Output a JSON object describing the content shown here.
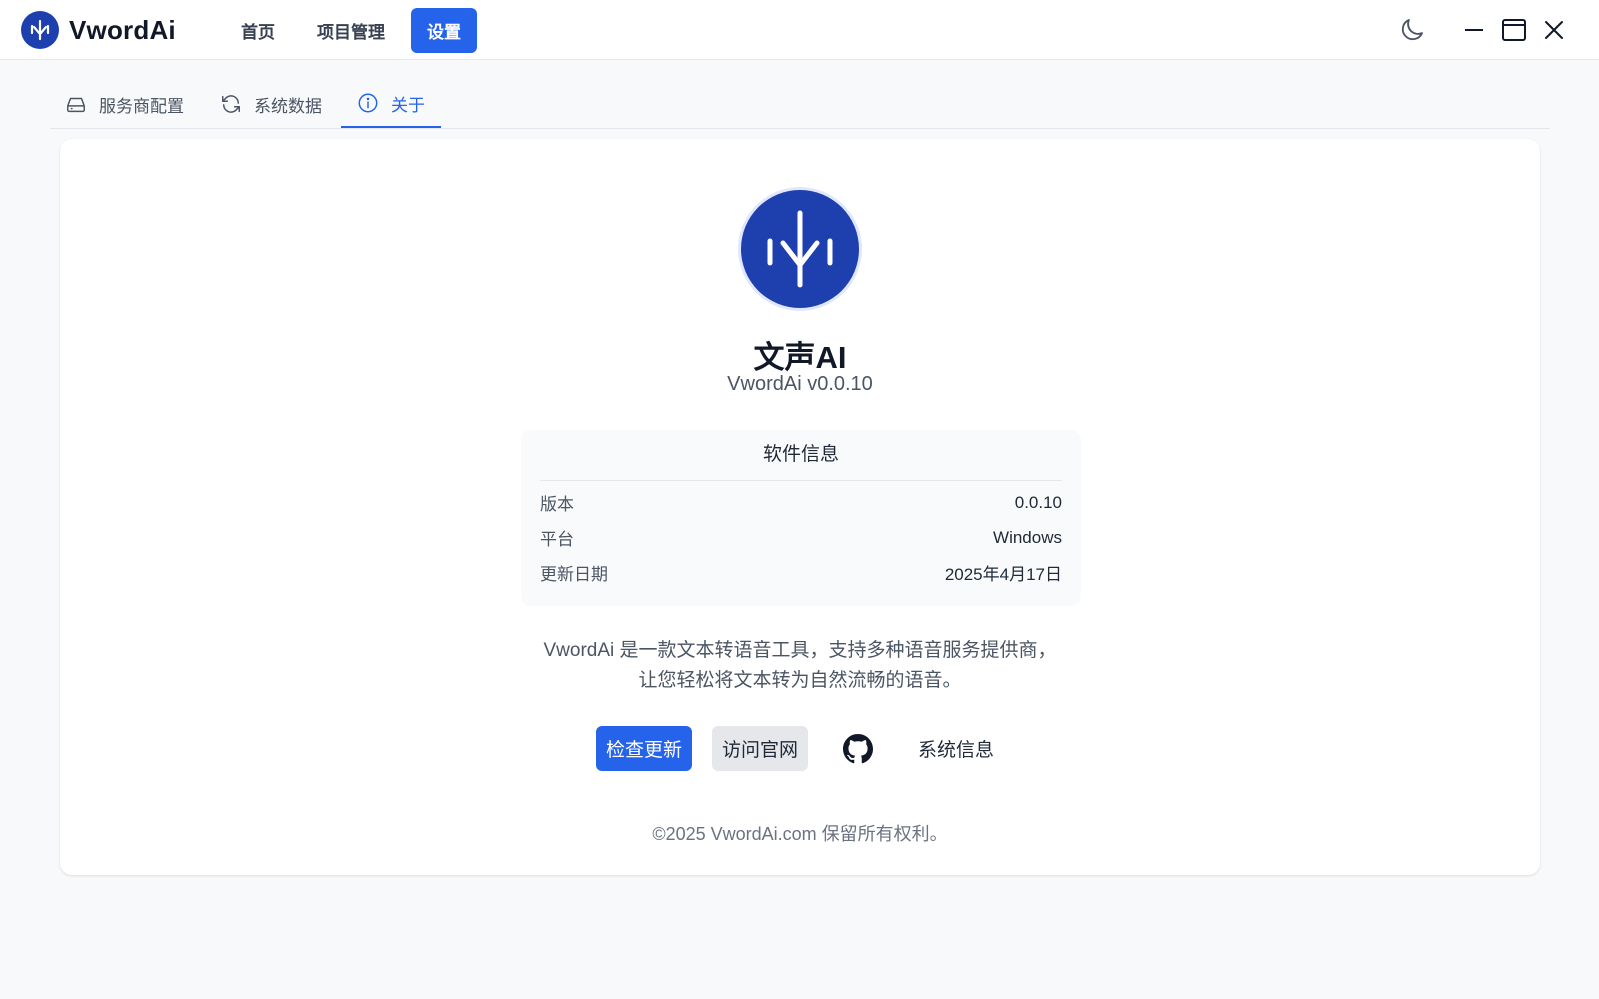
{
  "app": {
    "name": "VwordAi"
  },
  "nav": {
    "items": [
      {
        "label": "首页"
      },
      {
        "label": "项目管理"
      },
      {
        "label": "设置"
      }
    ]
  },
  "tabs": [
    {
      "label": "服务商配置"
    },
    {
      "label": "系统数据"
    },
    {
      "label": "关于"
    }
  ],
  "about": {
    "title": "文声AI",
    "version": "VwordAi v0.0.10",
    "info": {
      "title": "软件信息",
      "rows": [
        {
          "key": "版本",
          "value": "0.0.10"
        },
        {
          "key": "平台",
          "value": "Windows"
        },
        {
          "key": "更新日期",
          "value": "2025年4月17日"
        }
      ]
    },
    "description_line1": "VwordAi 是一款文本转语音工具，支持多种语音服务提供商，",
    "description_line2": "让您轻松将文本转为自然流畅的语音。",
    "buttons": {
      "check_update": "检查更新",
      "visit_site": "访问官网",
      "system_info": "系统信息"
    },
    "copyright": "©2025 VwordAi.com 保留所有权利。"
  },
  "icons": {
    "brand_logo": "tree-logo-icon",
    "theme": "moon-icon",
    "minimize": "minimize-icon",
    "maximize": "maximize-icon",
    "close": "close-icon",
    "tab_provider": "drive-icon",
    "tab_data": "refresh-icon",
    "tab_about": "info-icon",
    "github": "github-icon"
  },
  "colors": {
    "primary": "#2563eb",
    "logo_bg": "#1e3fae"
  }
}
